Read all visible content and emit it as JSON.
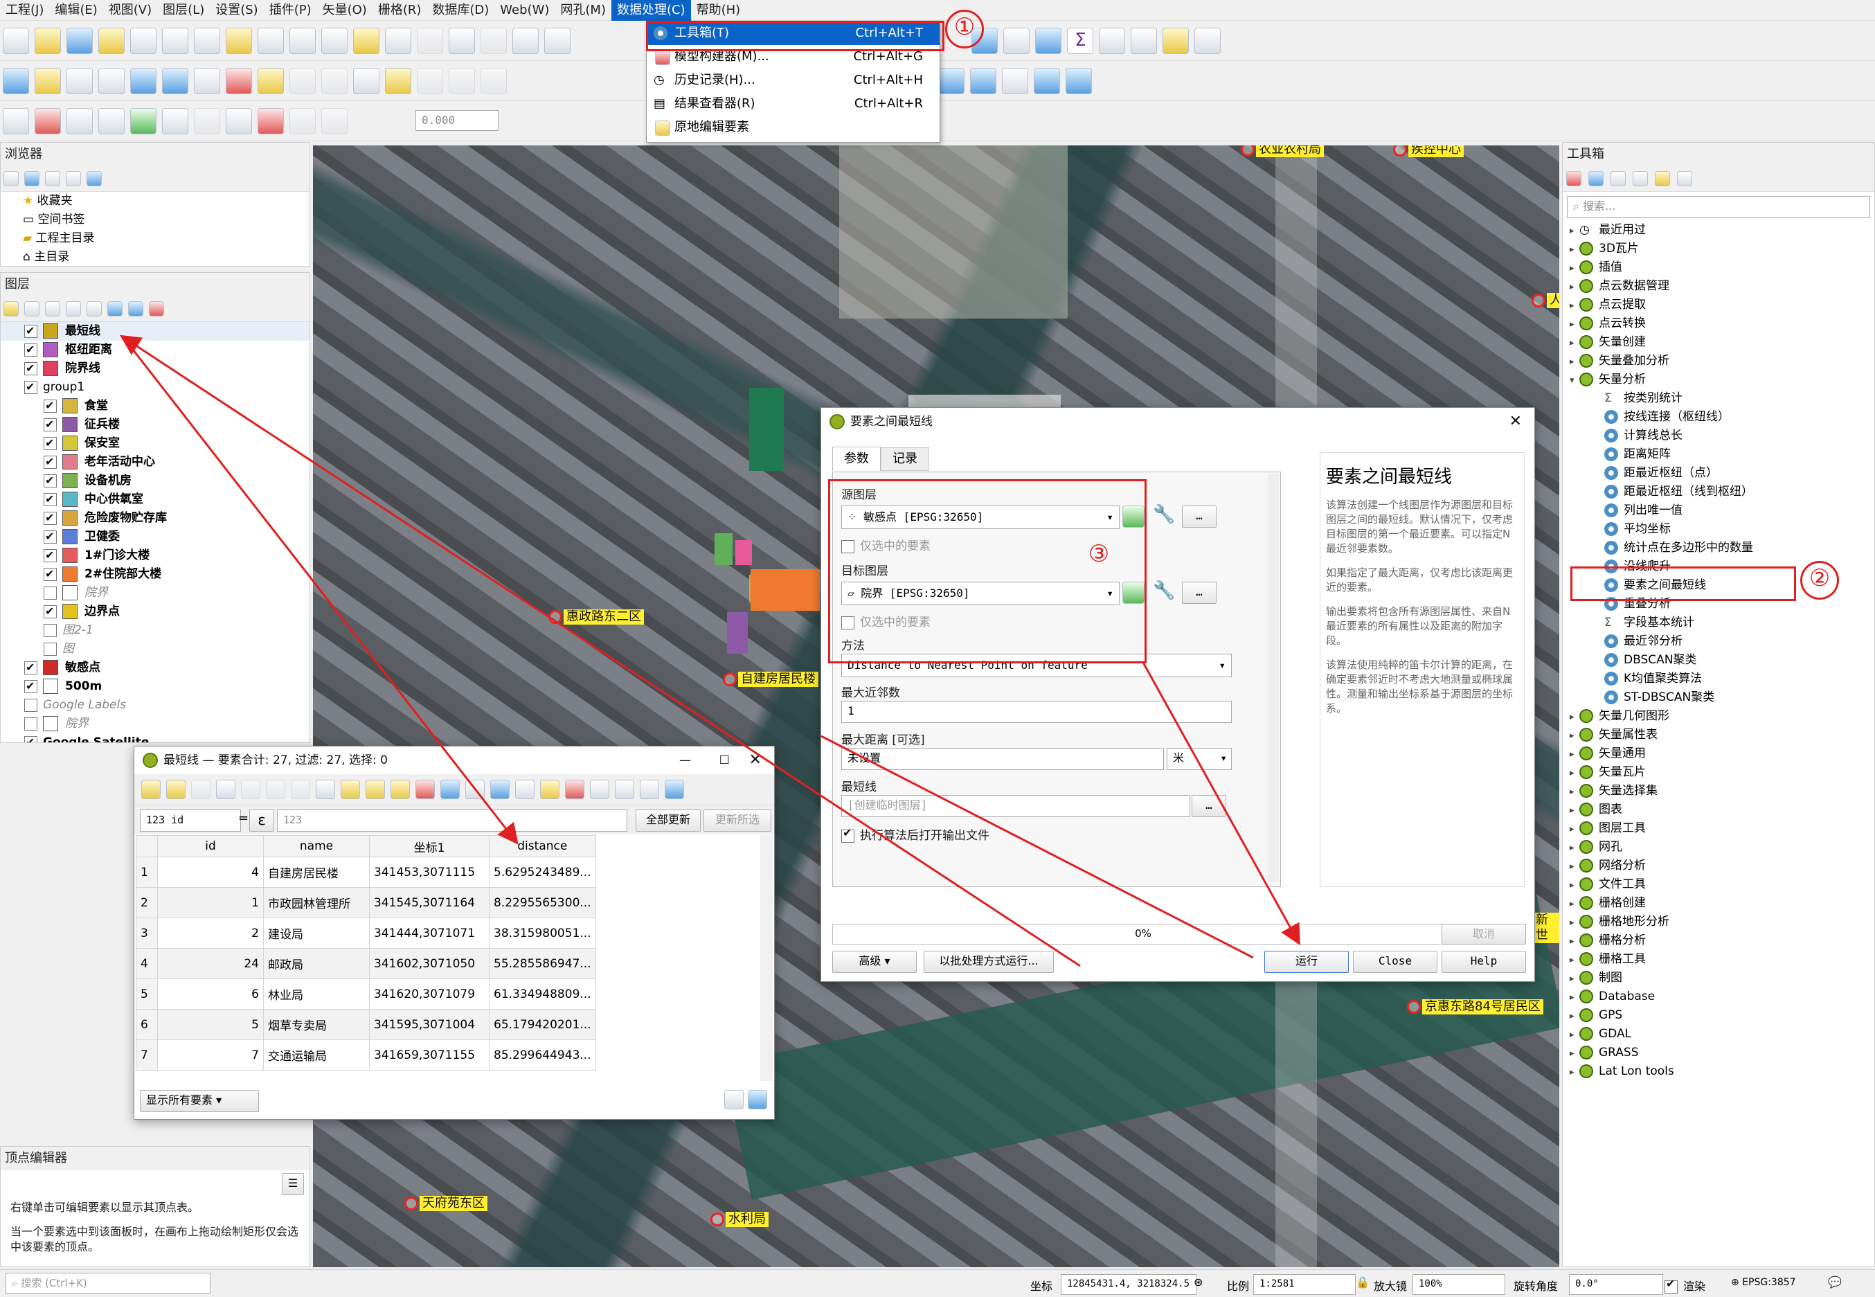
{
  "menubar": {
    "items": [
      "工程(J)",
      "编辑(E)",
      "视图(V)",
      "图层(L)",
      "设置(S)",
      "插件(P)",
      "矢量(O)",
      "栅格(R)",
      "数据库(D)",
      "Web(W)",
      "网孔(M)",
      "数据处理(C)",
      "帮助(H)"
    ]
  },
  "processing_menu": {
    "items": [
      {
        "label": "工具箱(T)",
        "shortcut": "Ctrl+Alt+T"
      },
      {
        "label": "模型构建器(M)...",
        "shortcut": "Ctrl+Alt+G"
      },
      {
        "label": "历史记录(H)...",
        "shortcut": "Ctrl+Alt+H"
      },
      {
        "label": "结果查看器(R)",
        "shortcut": "Ctrl+Alt+R"
      },
      {
        "label": "原地编辑要素",
        "shortcut": ""
      }
    ]
  },
  "toolbar": {
    "scale_value": "0.000"
  },
  "browser": {
    "title": "浏览器",
    "items": [
      "收藏夹",
      "空间书签",
      "工程主目录",
      "主目录"
    ]
  },
  "layers": {
    "title": "图层",
    "items": [
      {
        "label": "最短线",
        "checked": true,
        "bold": true,
        "color": "#c9a61b"
      },
      {
        "label": "枢纽距离",
        "checked": true,
        "bold": true,
        "color": "#b05cc0"
      },
      {
        "label": "院界线",
        "checked": true,
        "bold": true,
        "color": "#e04060"
      },
      {
        "label": "group1",
        "checked": true,
        "bold": false,
        "color": ""
      },
      {
        "label": "食堂",
        "checked": true,
        "bold": true,
        "color": "#d7b53a"
      },
      {
        "label": "征兵楼",
        "checked": true,
        "bold": true,
        "color": "#8e5aa8"
      },
      {
        "label": "保安室",
        "checked": true,
        "bold": true,
        "color": "#d6c63b"
      },
      {
        "label": "老年活动中心",
        "checked": true,
        "bold": true,
        "color": "#e07b8a"
      },
      {
        "label": "设备机房",
        "checked": true,
        "bold": true,
        "color": "#7fb04f"
      },
      {
        "label": "中心供氧室",
        "checked": true,
        "bold": true,
        "color": "#59b7c8"
      },
      {
        "label": "危险废物贮存库",
        "checked": true,
        "bold": true,
        "color": "#d9a53c"
      },
      {
        "label": "卫健委",
        "checked": true,
        "bold": true,
        "color": "#5b7fd6"
      },
      {
        "label": "1#门诊大楼",
        "checked": true,
        "bold": true,
        "color": "#e65c5c"
      },
      {
        "label": "2#住院部大楼",
        "checked": true,
        "bold": true,
        "color": "#ef7a2f"
      },
      {
        "label": "院界",
        "checked": false,
        "bold": false,
        "color": "#ffffff"
      },
      {
        "label": "边界点",
        "checked": true,
        "bold": true,
        "color": "#e6c21e"
      },
      {
        "label": "图2-1",
        "checked": false,
        "bold": false,
        "color": ""
      },
      {
        "label": "图",
        "checked": false,
        "bold": false,
        "color": ""
      },
      {
        "label": "敏感点",
        "checked": true,
        "bold": true,
        "color": "#d02a2a"
      },
      {
        "label": "500m",
        "checked": true,
        "bold": true,
        "color": "#ffffff"
      },
      {
        "label": "Google Labels",
        "checked": false,
        "bold": false,
        "color": ""
      },
      {
        "label": "院界",
        "checked": false,
        "bold": false,
        "color": "#ffffff"
      },
      {
        "label": "Google Satellite",
        "checked": true,
        "bold": true,
        "color": ""
      }
    ]
  },
  "vertex_editor": {
    "title": "顶点编辑器",
    "text1": "右键单击可编辑要素以显示其顶点表。",
    "text2": "当一个要素选中到该面板时，在画布上拖动绘制矩形仅会选中该要素的顶点。"
  },
  "search_box": {
    "placeholder": "搜索 (Ctrl+K)"
  },
  "map_labels": [
    {
      "text": "农业农村局"
    },
    {
      "text": "疾控中心"
    },
    {
      "text": "惠政路东二区"
    },
    {
      "text": "自建房居民楼"
    },
    {
      "text": "京惠东路84号居民区"
    },
    {
      "text": "天府苑东区"
    },
    {
      "text": "水利局"
    },
    {
      "text": "人"
    },
    {
      "text": "新世"
    }
  ],
  "attr_table": {
    "title": "最短线 — 要素合计: 27, 过滤: 27, 选择: 0",
    "field_select": "123 id",
    "expr_value": "123",
    "update_all": "全部更新",
    "update_selected": "更新所选",
    "show_all": "显示所有要素",
    "columns": [
      "id",
      "name",
      "坐标1",
      "distance"
    ],
    "rows": [
      [
        "1",
        "4",
        "自建房居民楼",
        "341453,3071115",
        "5.6295243489..."
      ],
      [
        "2",
        "1",
        "市政园林管理所",
        "341545,3071164",
        "8.2295565300..."
      ],
      [
        "3",
        "2",
        "建设局",
        "341444,3071071",
        "38.315980051..."
      ],
      [
        "4",
        "24",
        "邮政局",
        "341602,3071050",
        "55.285586947..."
      ],
      [
        "5",
        "6",
        "林业局",
        "341620,3071079",
        "61.334948809..."
      ],
      [
        "6",
        "5",
        "烟草专卖局",
        "341595,3071004",
        "65.179420201..."
      ],
      [
        "7",
        "7",
        "交通运输局",
        "341659,3071155",
        "85.299644943..."
      ]
    ]
  },
  "dialog": {
    "title": "要素之间最短线",
    "tab_params": "参数",
    "tab_log": "记录",
    "source_label": "源图层",
    "source_value": "敏感点 [EPSG:32650]",
    "selected_only": "仅选中的要素",
    "target_label": "目标图层",
    "target_value": "院界 [EPSG:32650]",
    "method_label": "方法",
    "method_value": "Distance to Nearest Point on feature",
    "max_neighbors_label": "最大近邻数",
    "max_neighbors_value": "1",
    "max_distance_label": "最大距离 [可选]",
    "max_distance_value": "未设置",
    "unit": "米",
    "output_label": "最短线",
    "output_placeholder": "[创建临时图层]",
    "open_after": "执行算法后打开输出文件",
    "help_title": "要素之间最短线",
    "help_p1": "该算法创建一个线图层作为源图层和目标图层之间的最短线。默认情况下，仅考虑目标图层的第一个最近要素。可以指定N最近邻要素数。",
    "help_p2": "如果指定了最大距离，仅考虑比该距离更近的要素。",
    "help_p3": "输出要素将包含所有源图层属性、来自N最近要素的所有属性以及距离的附加字段。",
    "help_p4": "该算法使用纯粹的笛卡尔计算的距离，在确定要素邻近时不考虑大地测量或椭球属性。测量和输出坐标系基于源图层的坐标系。",
    "progress": "0%",
    "cancel": "取消",
    "advanced": "高级",
    "batch": "以批处理方式运行...",
    "run": "运行",
    "close": "Close",
    "help": "Help"
  },
  "toolbox": {
    "title": "工具箱",
    "search_placeholder": "搜索...",
    "items": [
      {
        "label": "最近用过",
        "level": 0,
        "icon": "clock"
      },
      {
        "label": "3D瓦片",
        "level": 0,
        "icon": "qgis"
      },
      {
        "label": "插值",
        "level": 0,
        "icon": "qgis"
      },
      {
        "label": "点云数据管理",
        "level": 0,
        "icon": "qgis"
      },
      {
        "label": "点云提取",
        "level": 0,
        "icon": "qgis"
      },
      {
        "label": "点云转换",
        "level": 0,
        "icon": "qgis"
      },
      {
        "label": "矢量创建",
        "level": 0,
        "icon": "qgis"
      },
      {
        "label": "矢量叠加分析",
        "level": 0,
        "icon": "qgis"
      },
      {
        "label": "矢量分析",
        "level": 0,
        "icon": "qgis"
      },
      {
        "label": "按类别统计",
        "level": 1,
        "icon": "sigma"
      },
      {
        "label": "按线连接（枢纽线）",
        "level": 1,
        "icon": "gear"
      },
      {
        "label": "计算线总长",
        "level": 1,
        "icon": "gear"
      },
      {
        "label": "距离矩阵",
        "level": 1,
        "icon": "gear"
      },
      {
        "label": "距最近枢纽（点）",
        "level": 1,
        "icon": "gear"
      },
      {
        "label": "距最近枢纽（线到枢纽）",
        "level": 1,
        "icon": "gear"
      },
      {
        "label": "列出唯一值",
        "level": 1,
        "icon": "gear"
      },
      {
        "label": "平均坐标",
        "level": 1,
        "icon": "gear"
      },
      {
        "label": "统计点在多边形中的数量",
        "level": 1,
        "icon": "gear"
      },
      {
        "label": "沿线爬升",
        "level": 1,
        "icon": "gear"
      },
      {
        "label": "要素之间最短线",
        "level": 1,
        "icon": "gear"
      },
      {
        "label": "重叠分析",
        "level": 1,
        "icon": "gear"
      },
      {
        "label": "字段基本统计",
        "level": 1,
        "icon": "sigma"
      },
      {
        "label": "最近邻分析",
        "level": 1,
        "icon": "gear"
      },
      {
        "label": "DBSCAN聚类",
        "level": 1,
        "icon": "gear"
      },
      {
        "label": "K均值聚类算法",
        "level": 1,
        "icon": "gear"
      },
      {
        "label": "ST-DBSCAN聚类",
        "level": 1,
        "icon": "gear"
      },
      {
        "label": "矢量几何图形",
        "level": 0,
        "icon": "qgis"
      },
      {
        "label": "矢量属性表",
        "level": 0,
        "icon": "qgis"
      },
      {
        "label": "矢量通用",
        "level": 0,
        "icon": "qgis"
      },
      {
        "label": "矢量瓦片",
        "level": 0,
        "icon": "qgis"
      },
      {
        "label": "矢量选择集",
        "level": 0,
        "icon": "qgis"
      },
      {
        "label": "图表",
        "level": 0,
        "icon": "qgis"
      },
      {
        "label": "图层工具",
        "level": 0,
        "icon": "qgis"
      },
      {
        "label": "网孔",
        "level": 0,
        "icon": "qgis"
      },
      {
        "label": "网络分析",
        "level": 0,
        "icon": "qgis"
      },
      {
        "label": "文件工具",
        "level": 0,
        "icon": "qgis"
      },
      {
        "label": "栅格创建",
        "level": 0,
        "icon": "qgis"
      },
      {
        "label": "栅格地形分析",
        "level": 0,
        "icon": "qgis"
      },
      {
        "label": "栅格分析",
        "level": 0,
        "icon": "qgis"
      },
      {
        "label": "栅格工具",
        "level": 0,
        "icon": "qgis"
      },
      {
        "label": "制图",
        "level": 0,
        "icon": "qgis"
      },
      {
        "label": "Database",
        "level": 0,
        "icon": "qgis"
      },
      {
        "label": "GPS",
        "level": 0,
        "icon": "qgis"
      },
      {
        "label": "GDAL",
        "level": 0,
        "icon": "gdal"
      },
      {
        "label": "GRASS",
        "level": 0,
        "icon": "grass"
      },
      {
        "label": "Lat Lon tools",
        "level": 0,
        "icon": "latlon"
      }
    ]
  },
  "status": {
    "coord_label": "坐标",
    "coord_value": "12845431.4, 3218324.5",
    "scale_label": "比例",
    "scale_value": "1:2581",
    "magnifier_label": "放大镜",
    "magnifier_value": "100%",
    "rotation_label": "旋转角度",
    "rotation_value": "0.0°",
    "render_label": "渲染",
    "crs": "EPSG:3857"
  },
  "annotations": {
    "n1": "①",
    "n2": "②",
    "n3": "③"
  }
}
